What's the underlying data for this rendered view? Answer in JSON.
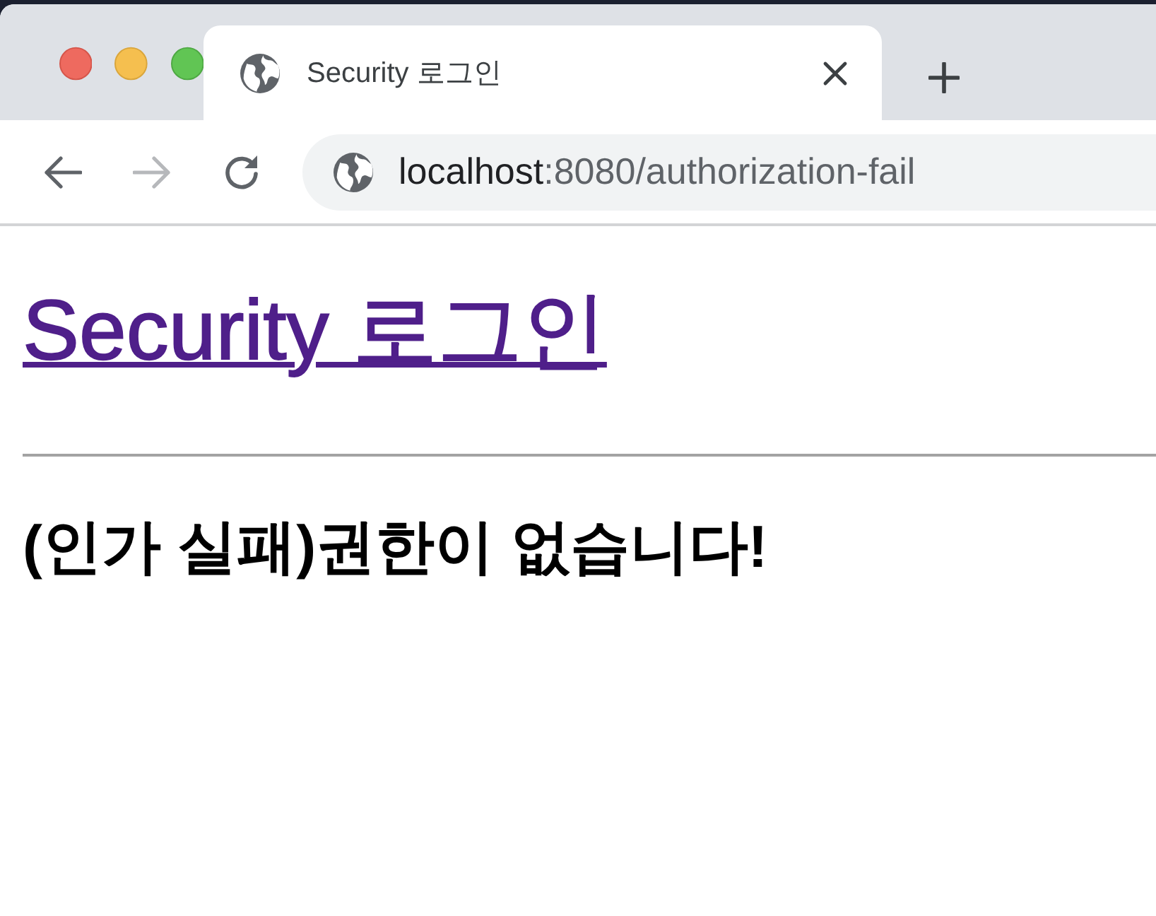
{
  "tabs": [
    {
      "title": "Security 로그인",
      "selected": true
    }
  ],
  "navigation": [
    {
      "kind": "back",
      "disabled": false
    },
    {
      "kind": "forward",
      "disabled": true
    },
    {
      "kind": "reload",
      "disabled": false
    }
  ],
  "address_bar": {
    "host": "localhost",
    "rest": ":8080/authorization-fail"
  },
  "page": {
    "heading_link": "Security 로그인",
    "message": "(인가 실패)권한이 없습니다!"
  }
}
